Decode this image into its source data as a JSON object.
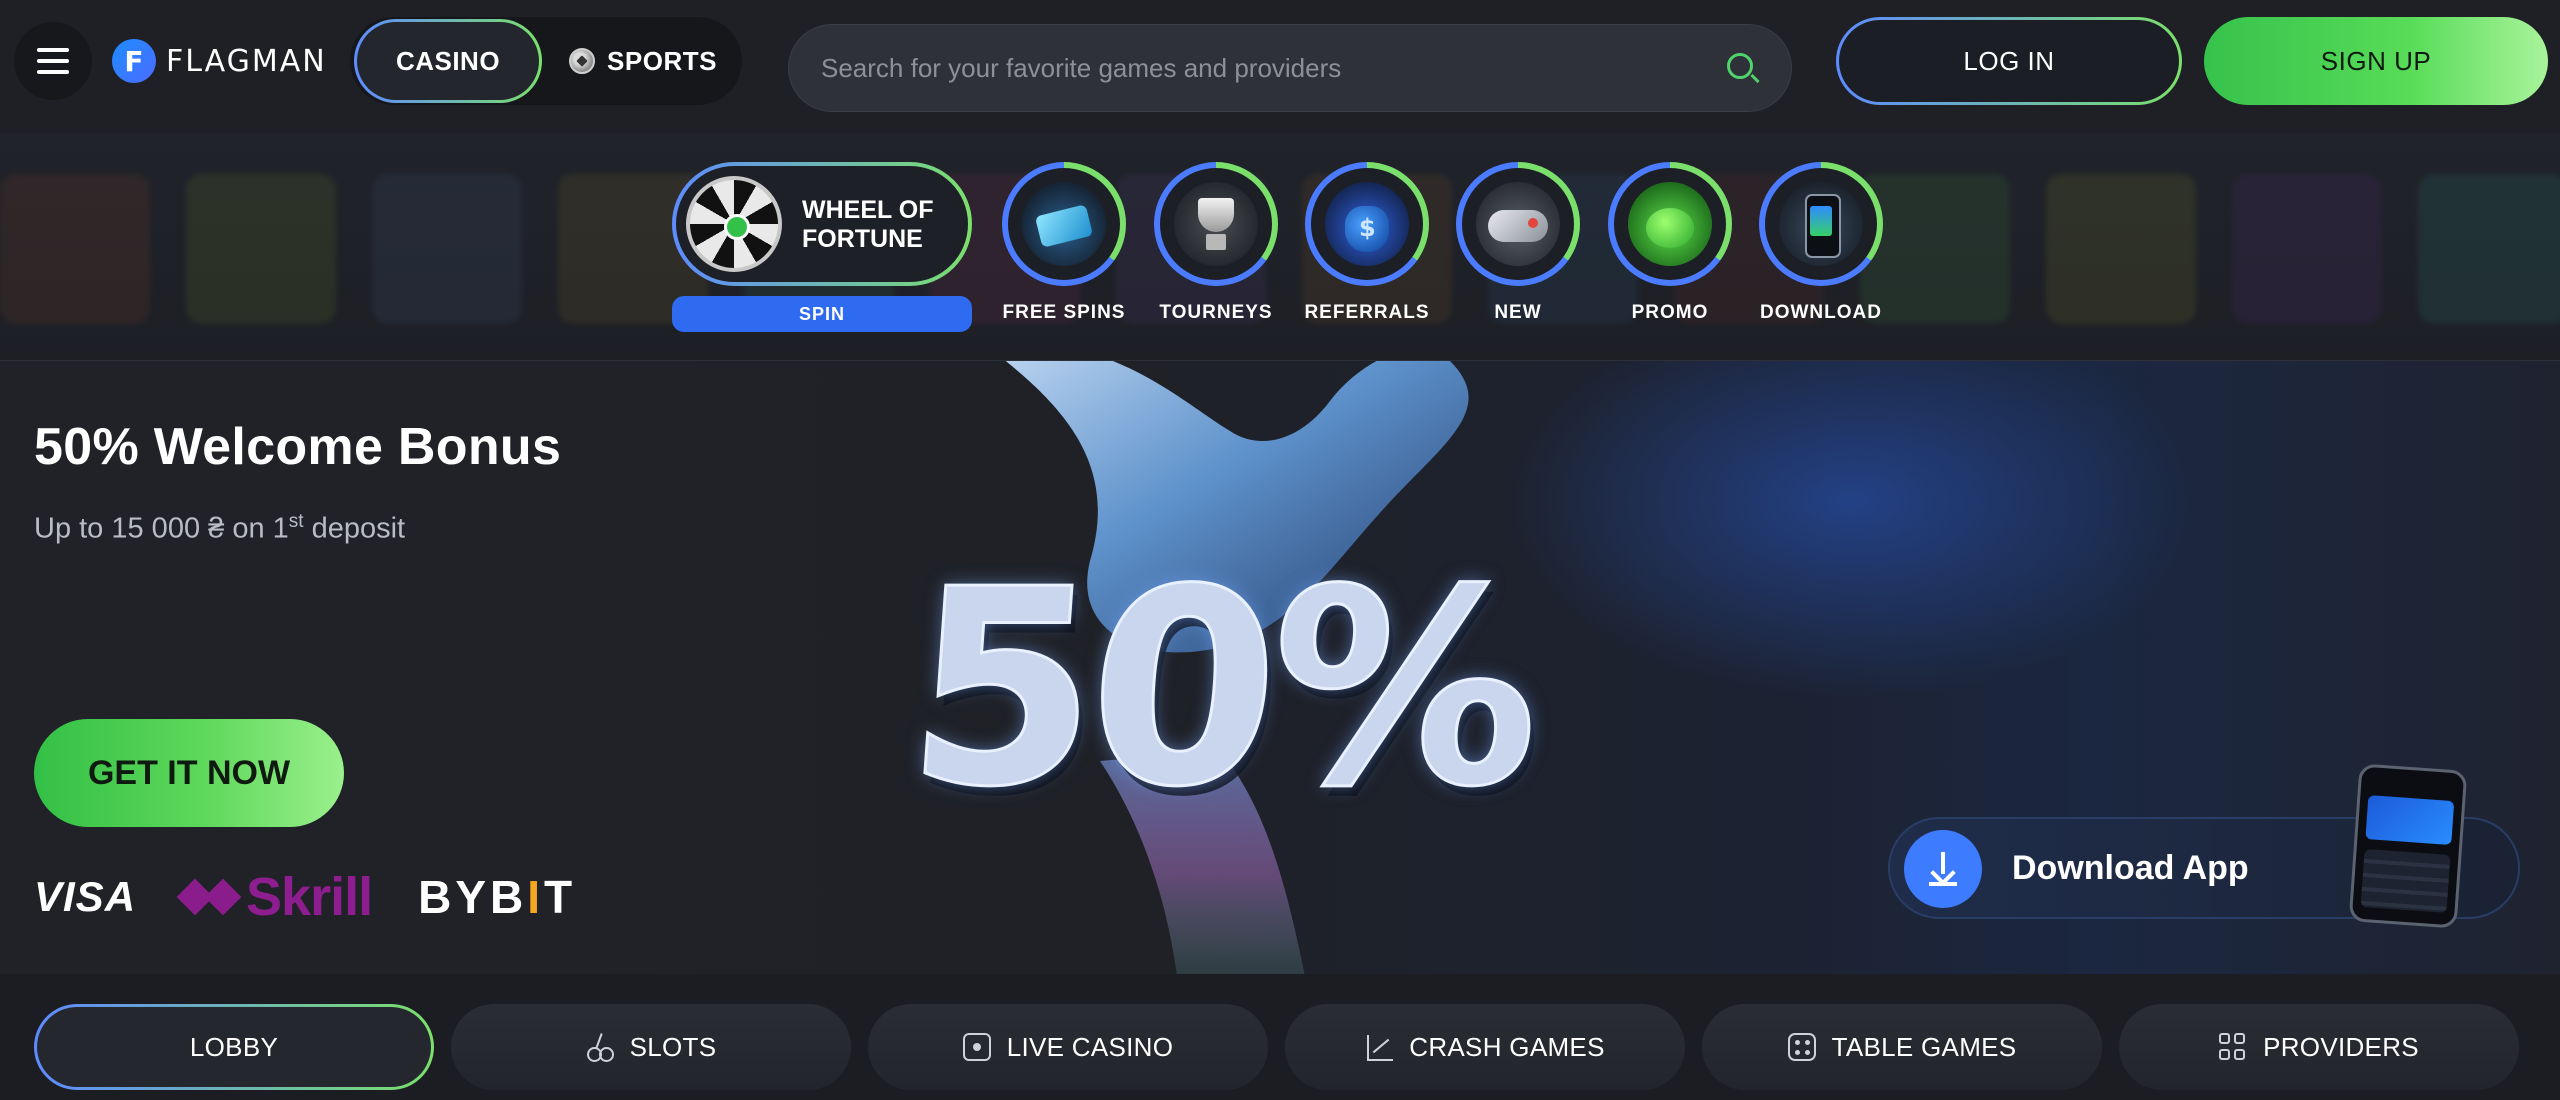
{
  "header": {
    "logo_letter": "F",
    "logo_text": "FLAGMAN",
    "modes": {
      "casino": "CASINO",
      "sports": "SPORTS"
    },
    "search": {
      "placeholder": "Search for your favorite games and providers"
    },
    "login_label": "LOG IN",
    "signup_label": "SIGN UP"
  },
  "quicknav": {
    "wheel": {
      "title": "WHEEL OF FORTUNE",
      "button": "SPIN"
    },
    "items": [
      {
        "label": "FREE SPINS",
        "icon": "ticket-icon"
      },
      {
        "label": "TOURNEYS",
        "icon": "trophy-icon"
      },
      {
        "label": "REFERRALS",
        "icon": "money-bag-icon"
      },
      {
        "label": "NEW",
        "icon": "gamepad-icon"
      },
      {
        "label": "PROMO",
        "icon": "piggy-bank-icon"
      },
      {
        "label": "DOWNLOAD",
        "icon": "phone-icon"
      }
    ]
  },
  "hero": {
    "title": "50% Welcome Bonus",
    "subtitle_main": "Up to 15 000 ₴ on 1",
    "subtitle_sup": "st",
    "subtitle_end": " deposit",
    "big_text": "50%",
    "cta": "GET IT NOW",
    "payments": {
      "visa": "VISA",
      "skrill": "Skrill",
      "bybit_a": "BYB",
      "bybit_i": "I",
      "bybit_b": "T"
    },
    "download_app": "Download App"
  },
  "categories": [
    {
      "label": "LOBBY",
      "icon": ""
    },
    {
      "label": "SLOTS",
      "icon": "cherry-icon"
    },
    {
      "label": "LIVE CASINO",
      "icon": "live-icon"
    },
    {
      "label": "CRASH GAMES",
      "icon": "crash-chart-icon"
    },
    {
      "label": "TABLE GAMES",
      "icon": "dice-icon"
    },
    {
      "label": "PROVIDERS",
      "icon": "grid-icon"
    }
  ],
  "colors": {
    "accent_green": "#4fd36c",
    "accent_blue": "#3d7bff",
    "background": "#1b1d22",
    "skrill_purple": "#8e1d90",
    "bybit_orange": "#f5a623"
  }
}
